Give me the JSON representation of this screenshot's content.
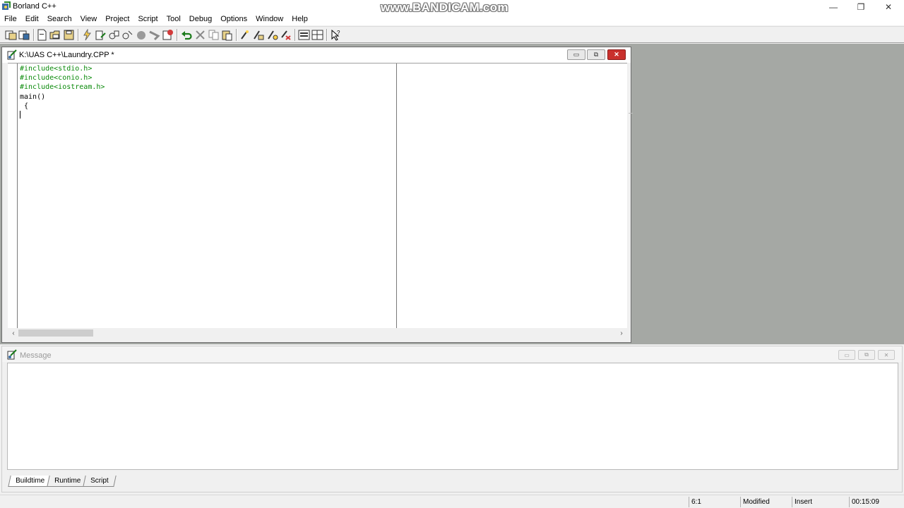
{
  "titlebar": {
    "title": "Borland C++",
    "watermark": "www.BANDICAM.com",
    "minimize_glyph": "—",
    "restore_glyph": "❐",
    "close_glyph": "✕"
  },
  "menu": [
    "File",
    "Edit",
    "Search",
    "View",
    "Project",
    "Script",
    "Tool",
    "Debug",
    "Options",
    "Window",
    "Help"
  ],
  "toolbar": {
    "buttons": [
      "project-open-icon",
      "project-save-icon",
      "new-file-icon",
      "open-file-icon",
      "save-file-icon",
      "make-icon",
      "build-icon",
      "compile-icon",
      "link-icon",
      "run-icon",
      "step-icon",
      "breakpoint-icon",
      "undo-icon",
      "cut-icon",
      "copy-icon",
      "paste-icon",
      "find-icon",
      "replace-icon",
      "search-again-icon",
      "browse-icon",
      "layout-icon",
      "table-icon",
      "help-pointer-icon"
    ]
  },
  "editor": {
    "title": "K:\\UAS C++\\Laundry.CPP *",
    "minimize_glyph": "▭",
    "maximize_glyph": "⧉",
    "close_glyph": "✕",
    "lines": [
      {
        "text": "#include<stdio.h>",
        "kind": "preprocessor"
      },
      {
        "text": "#include<conio.h>",
        "kind": "preprocessor"
      },
      {
        "text": "#include<iostream.h>",
        "kind": "preprocessor"
      },
      {
        "text": "main()",
        "kind": "plain"
      },
      {
        "text": " {",
        "kind": "plain"
      }
    ],
    "scroll_left_glyph": "‹",
    "scroll_right_glyph": "›"
  },
  "message": {
    "title": "Message",
    "minimize_glyph": "▭",
    "maximize_glyph": "⧉",
    "close_glyph": "✕",
    "tabs": [
      "Buildtime",
      "Runtime",
      "Script"
    ],
    "active_tab": "Buildtime"
  },
  "status": {
    "position": "6:1",
    "modified": "Modified",
    "mode": "Insert",
    "time": "00:15:09"
  },
  "colors": {
    "preprocessor": "#0a8a0a",
    "mdi_background": "#a5a8a4",
    "close_button": "#c9302c"
  }
}
